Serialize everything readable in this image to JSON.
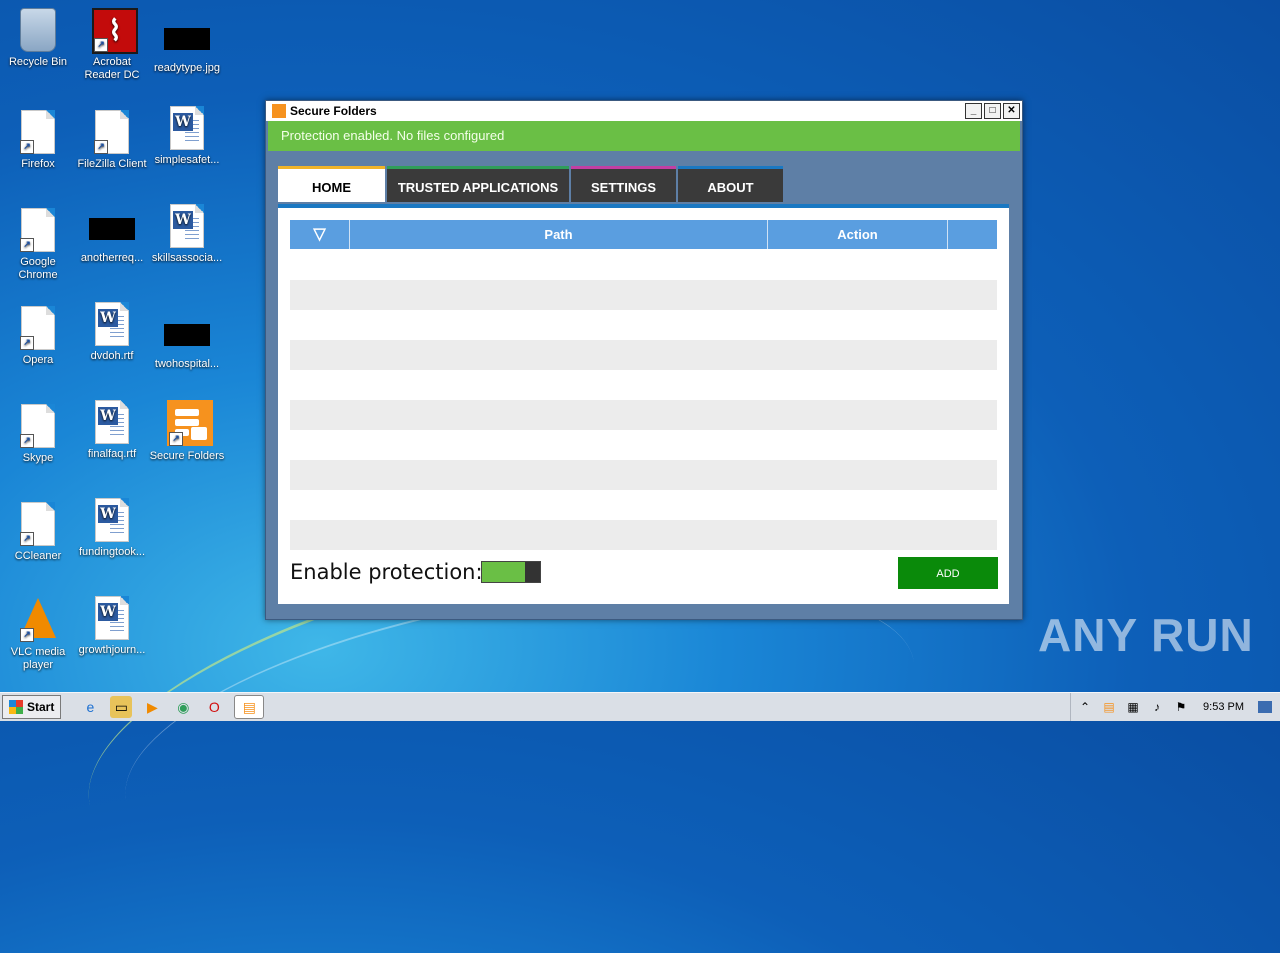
{
  "desktop_icons": [
    {
      "label": "Recycle Bin"
    },
    {
      "label": "Acrobat Reader DC"
    },
    {
      "label": "readytype.jpg"
    },
    {
      "label": "Firefox"
    },
    {
      "label": "FileZilla Client"
    },
    {
      "label": "simplesafet..."
    },
    {
      "label": "Google Chrome"
    },
    {
      "label": "anotherreq..."
    },
    {
      "label": "skillsassocia..."
    },
    {
      "label": "Opera"
    },
    {
      "label": "dvdoh.rtf"
    },
    {
      "label": "twohospital..."
    },
    {
      "label": "Skype"
    },
    {
      "label": "finalfaq.rtf"
    },
    {
      "label": "Secure Folders"
    },
    {
      "label": "CCleaner"
    },
    {
      "label": "fundingtook..."
    },
    {
      "label": "VLC media player"
    },
    {
      "label": "growthjourn..."
    }
  ],
  "window": {
    "title": "Secure Folders",
    "status": "Protection enabled. No files configured",
    "tabs": [
      {
        "label": "HOME",
        "color": "#f0b429"
      },
      {
        "label": "TRUSTED APPLICATIONS",
        "color": "#2f9e5a"
      },
      {
        "label": "SETTINGS",
        "color": "#c23fa3"
      },
      {
        "label": "ABOUT",
        "color": "#1a78c2"
      }
    ],
    "grid": {
      "columns": [
        "Path",
        "Action"
      ]
    },
    "enable_label": "Enable protection:",
    "protection_enabled": true,
    "add_button": "ADD"
  },
  "taskbar": {
    "start_label": "Start",
    "clock": "9:53 PM"
  },
  "watermark": "ANY RUN",
  "colors": {
    "status_green": "#6abf45",
    "accent_blue": "#1a78c2",
    "add_green": "#0a8a0a"
  }
}
